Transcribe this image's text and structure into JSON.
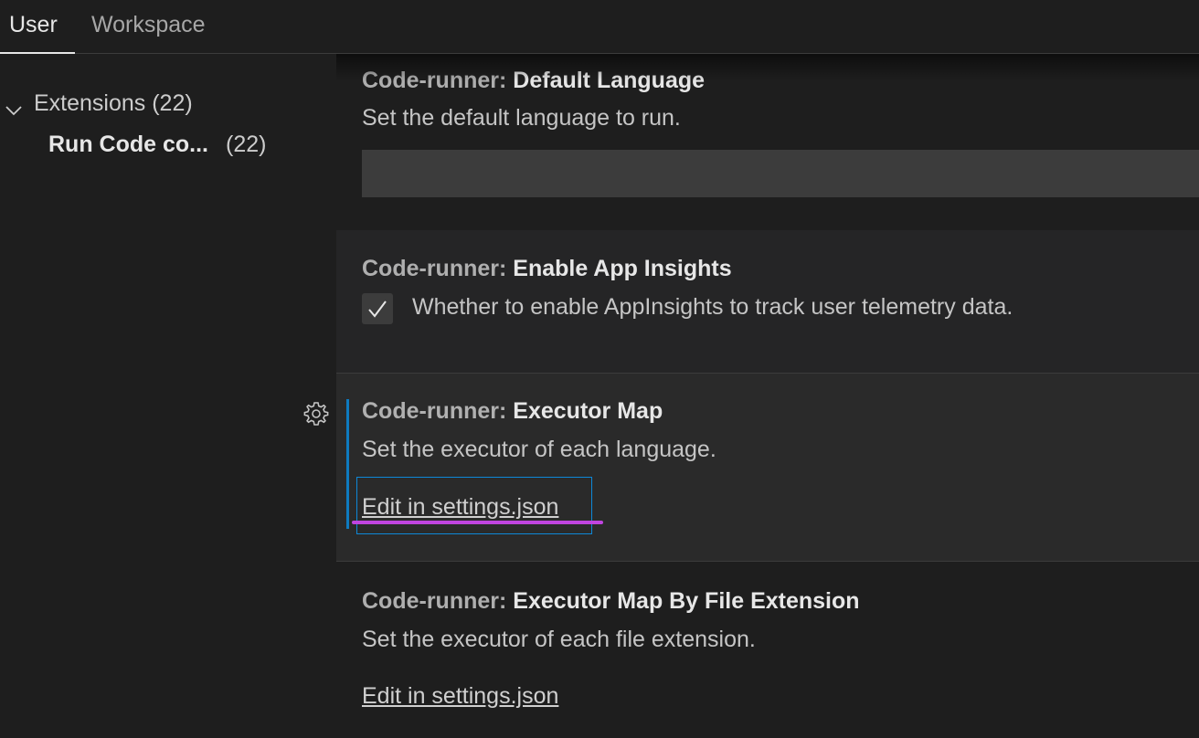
{
  "tabs": [
    {
      "label": "User",
      "active": true
    },
    {
      "label": "Workspace",
      "active": false
    }
  ],
  "toc": {
    "group_label": "Extensions (22)",
    "item_label": "Run Code co...",
    "item_count": "(22)"
  },
  "settings": {
    "default_language": {
      "category": "Code-runner: ",
      "key": "Default Language",
      "description": "Set the default language to run.",
      "value": ""
    },
    "app_insights": {
      "category": "Code-runner: ",
      "key": "Enable App Insights",
      "description": "Whether to enable AppInsights to track user telemetry data.",
      "checked": true
    },
    "executor_map": {
      "category": "Code-runner: ",
      "key": "Executor Map",
      "description": "Set the executor of each language.",
      "link": "Edit in settings.json"
    },
    "executor_map_ext": {
      "category": "Code-runner: ",
      "key": "Executor Map By File Extension",
      "description": "Set the executor of each file extension.",
      "link": "Edit in settings.json"
    }
  },
  "colors": {
    "background": "#1e1e1e",
    "focus_accent": "#0e7abf",
    "highlight_underline": "#c044e0"
  },
  "icons": {
    "chevron": "chevron-down-icon",
    "gear": "gear-icon",
    "check": "check-icon"
  }
}
